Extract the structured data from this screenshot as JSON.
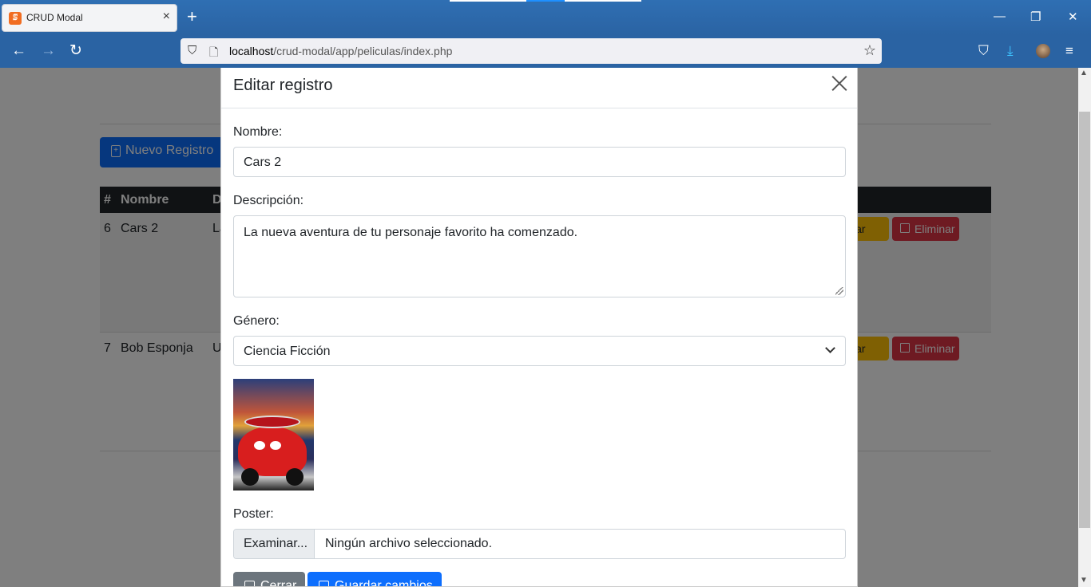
{
  "browser": {
    "tab_title": "CRUD Modal",
    "tab_icon": "xampp-icon",
    "new_tab": "+",
    "url_host": "localhost",
    "url_path": "/crud-modal/app/peliculas/index.php"
  },
  "page": {
    "new_record_label": "Nuevo Registro",
    "table_headers": [
      "#",
      "Nombre",
      "D"
    ],
    "rows": [
      {
        "id": "6",
        "name": "Cars 2",
        "desc": "La",
        "edit_label": "Editar",
        "delete_label": "Eliminar"
      },
      {
        "id": "7",
        "name": "Bob Esponja",
        "desc": "U",
        "edit_label": "Editar",
        "delete_label": "Eliminar"
      }
    ]
  },
  "modal": {
    "title": "Editar registro",
    "nombre_label": "Nombre:",
    "nombre_value": "Cars 2",
    "descripcion_label": "Descripción:",
    "descripcion_value": "La nueva aventura de tu personaje favorito ha comenzado.",
    "genero_label": "Género:",
    "genero_value": "Ciencia Ficción",
    "poster_label": "Poster:",
    "file_button": "Examinar...",
    "file_status": "Ningún archivo seleccionado.",
    "close_button": "Cerrar",
    "save_button": "Guardar cambios"
  },
  "colors": {
    "browser_chrome": "#2a63a3",
    "primary": "#0d6efd",
    "warning": "#ffc107",
    "danger": "#dc3545",
    "secondary": "#6c757d",
    "table_header": "#212529"
  }
}
